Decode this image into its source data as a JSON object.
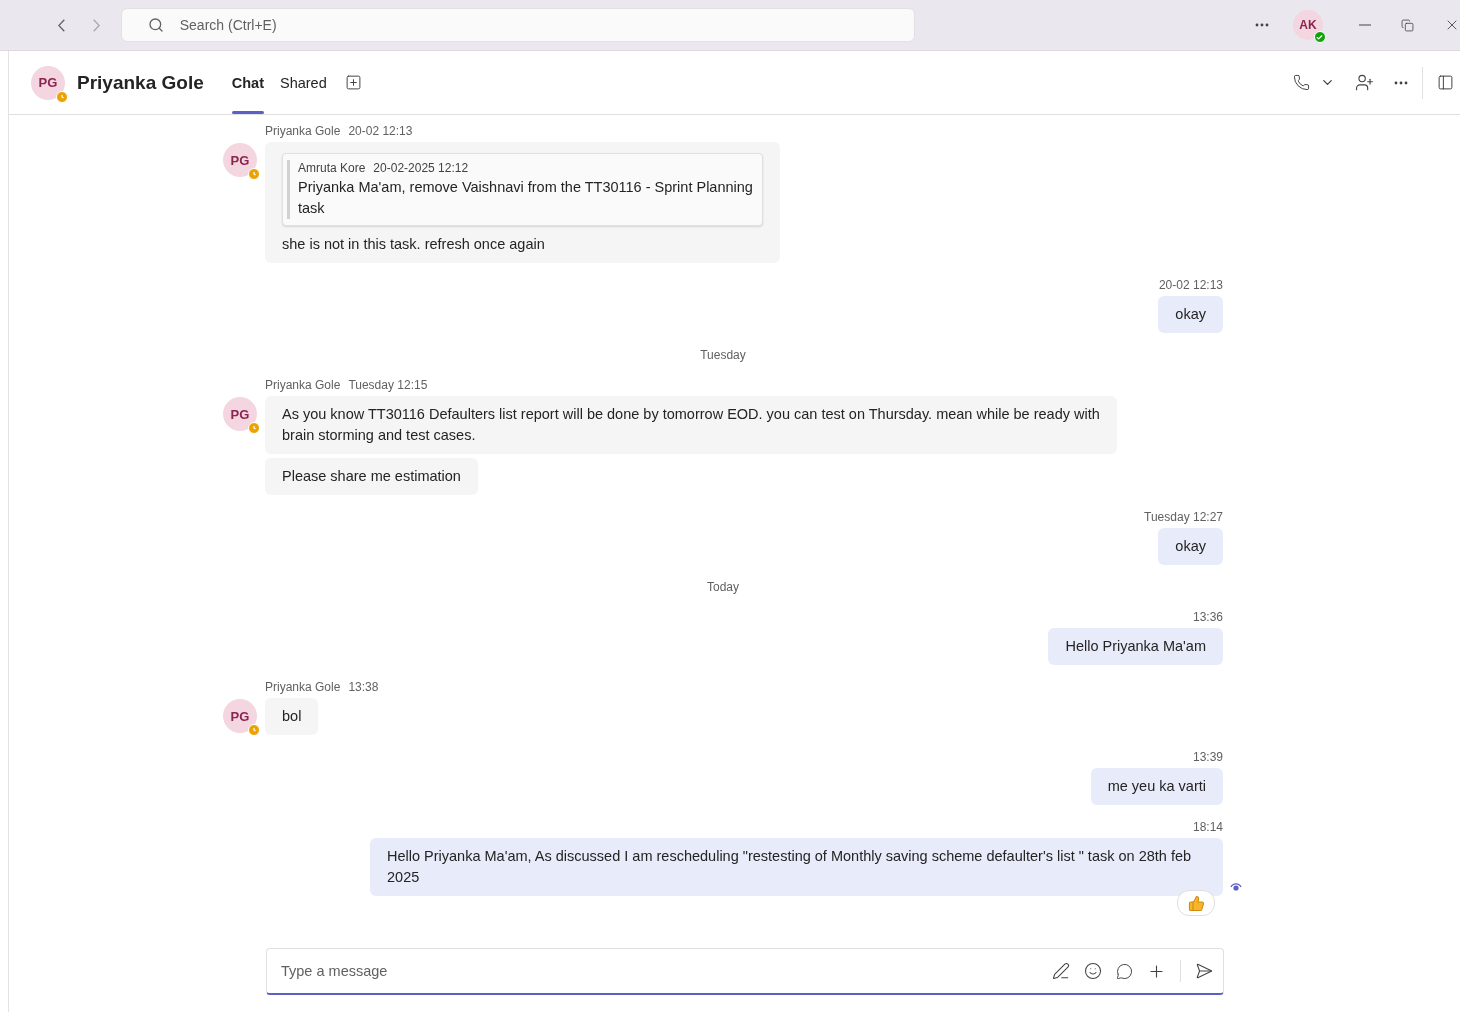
{
  "top_bar": {
    "search": {
      "placeholder": "Search (Ctrl+E)"
    },
    "user": {
      "initials": "AK",
      "available": true
    }
  },
  "header": {
    "contact": {
      "initials": "PG",
      "name": "Priyanka Gole",
      "away": true
    },
    "tabs": [
      {
        "label": "Chat",
        "selected": true
      },
      {
        "label": "Shared",
        "selected": false
      }
    ]
  },
  "messages": [
    {
      "kind": "incoming",
      "sender": "Priyanka Gole",
      "time": "20-02 12:13",
      "initials": "PG",
      "away": true,
      "bubbles": [
        {
          "quote": {
            "author": "Amruta Kore",
            "time": "20-02-2025 12:12",
            "text": "Priyanka Ma'am, remove Vaishnavi from the TT30116 - Sprint Planning task"
          },
          "text": "she is not in this task. refresh once again"
        }
      ]
    },
    {
      "kind": "outgoing",
      "time": "20-02 12:13",
      "text": "okay",
      "seen": false,
      "liked": false
    },
    {
      "kind": "divider",
      "label": "Tuesday"
    },
    {
      "kind": "incoming",
      "sender": "Priyanka Gole",
      "time": "Tuesday 12:15",
      "initials": "PG",
      "away": true,
      "bubbles": [
        {
          "text": "As you know TT30116 Defaulters list report will be done by tomorrow EOD. you can test on Thursday. mean while be ready with brain storming and test cases."
        },
        {
          "text": "Please share me estimation"
        }
      ]
    },
    {
      "kind": "outgoing",
      "time": "Tuesday 12:27",
      "text": "okay",
      "seen": false,
      "liked": false
    },
    {
      "kind": "divider",
      "label": "Today"
    },
    {
      "kind": "outgoing",
      "time": "13:36",
      "text": "Hello Priyanka Ma'am",
      "seen": false,
      "liked": false
    },
    {
      "kind": "incoming",
      "sender": "Priyanka Gole",
      "time": "13:38",
      "initials": "PG",
      "away": true,
      "bubbles": [
        {
          "text": "bol"
        }
      ]
    },
    {
      "kind": "outgoing",
      "time": "13:39",
      "text": "me yeu ka varti",
      "seen": false,
      "liked": false
    },
    {
      "kind": "outgoing",
      "time": "18:14",
      "text": "Hello Priyanka Ma'am, As discussed  I am rescheduling \"restesting of Monthly saving scheme defaulter's list \" task on 28th feb 2025",
      "seen": true,
      "liked": true
    }
  ],
  "composer": {
    "placeholder": "Type a message"
  }
}
